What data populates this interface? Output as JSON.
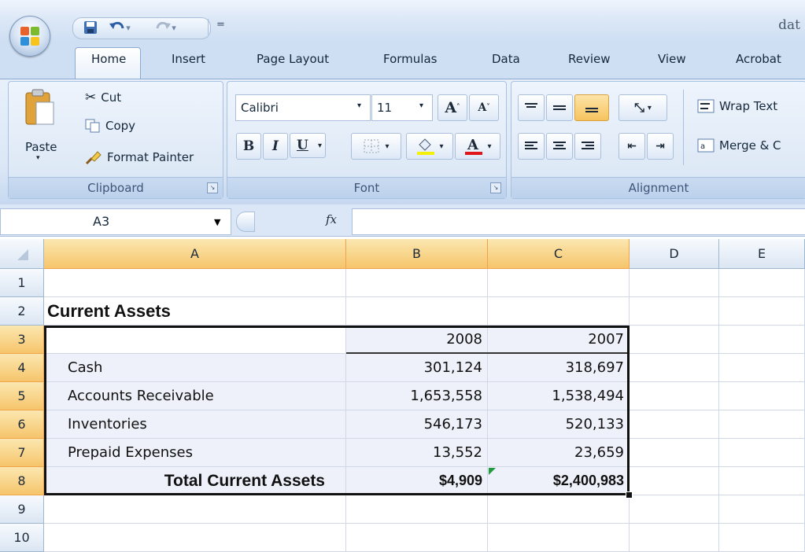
{
  "window": {
    "title_fragment": "dat"
  },
  "quick_access": {
    "customize_glyph": "="
  },
  "tabs": [
    "Home",
    "Insert",
    "Page Layout",
    "Formulas",
    "Data",
    "Review",
    "View",
    "Acrobat"
  ],
  "ribbon": {
    "clipboard": {
      "label": "Clipboard",
      "paste": "Paste",
      "cut": "Cut",
      "copy": "Copy",
      "format_painter": "Format Painter"
    },
    "font": {
      "label": "Font",
      "name": "Calibri",
      "size": "11",
      "bold": "B",
      "italic": "I",
      "underline": "U",
      "grow": "A",
      "shrink": "A"
    },
    "alignment": {
      "label": "Alignment",
      "wrap_text": "Wrap Text",
      "merge": "Merge & C"
    }
  },
  "formula_bar": {
    "name_box": "A3",
    "fx": "fx",
    "value": ""
  },
  "columns": [
    "A",
    "B",
    "C",
    "D",
    "E"
  ],
  "rows": [
    "1",
    "2",
    "3",
    "4",
    "5",
    "6",
    "7",
    "8",
    "9",
    "10"
  ],
  "active": {
    "cell": "A3",
    "column": "A",
    "rows": [
      "3",
      "4",
      "5",
      "6",
      "7",
      "8"
    ],
    "columns": [
      "A",
      "B",
      "C"
    ]
  },
  "cells": {
    "A2": "Current Assets",
    "B3": "2008",
    "C3": "2007",
    "A4": "Cash",
    "B4": "301,124",
    "C4": "318,697",
    "A5": "Accounts Receivable",
    "B5": "1,653,558",
    "C5": "1,538,494",
    "A6": "Inventories",
    "B6": "546,173",
    "C6": "520,133",
    "A7": "Prepaid Expenses",
    "B7": "13,552",
    "C7": "23,659",
    "A8": "Total Current Assets",
    "B8": "$4,909",
    "C8": "$2,400,983"
  },
  "colors": {
    "accent_header": "#f6c56b",
    "selection_tint": "#eef0fa",
    "error_indicator": "#1f9c3c"
  }
}
